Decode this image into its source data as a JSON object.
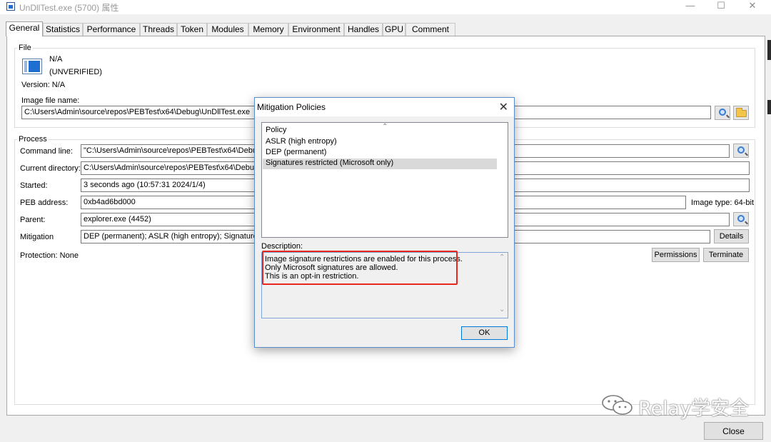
{
  "window": {
    "title": "UnDllTest.exe (5700) 属性",
    "minimize": "—",
    "maximize": "☐",
    "close": "✕"
  },
  "tabs": [
    "General",
    "Statistics",
    "Performance",
    "Threads",
    "Token",
    "Modules",
    "Memory",
    "Environment",
    "Handles",
    "GPU",
    "Comment"
  ],
  "file": {
    "group_label": "File",
    "description": "N/A",
    "verified": "(UNVERIFIED)",
    "version": "Version: N/A",
    "image_file_name_label": "Image file name:",
    "image_file_name": "C:\\Users\\Admin\\source\\repos\\PEBTest\\x64\\Debug\\UnDllTest.exe"
  },
  "process": {
    "group_label": "Process",
    "command_line_label": "Command line:",
    "command_line": "\"C:\\Users\\Admin\\source\\repos\\PEBTest\\x64\\Debug\\UnD",
    "current_directory_label": "Current directory:",
    "current_directory": "C:\\Users\\Admin\\source\\repos\\PEBTest\\x64\\Debug\\",
    "started_label": "Started:",
    "started": "3 seconds ago (10:57:31 2024/1/4)",
    "peb_address_label": "PEB address:",
    "peb_address": "0xb4ad6bd000",
    "image_type": "Image type:  64-bit",
    "parent_label": "Parent:",
    "parent": "explorer.exe (4452)",
    "mitigation_label": "Mitigation",
    "mitigation": "DEP (permanent); ASLR (high entropy); Signatures restr",
    "details_button": "Details",
    "protection": "Protection: None",
    "permissions_button": "Permissions",
    "terminate_button": "Terminate"
  },
  "dialog": {
    "title": "Mitigation Policies",
    "close": "✕",
    "list_header": "Policy",
    "sort_indicator": "⌃",
    "policies": [
      "ASLR (high entropy)",
      "DEP (permanent)",
      "Signatures restricted (Microsoft only)"
    ],
    "selected_index": 2,
    "description_label": "Description:",
    "description_lines": [
      "Image signature restrictions are enabled for this process.",
      "Only Microsoft signatures are allowed.",
      "This is an opt-in restriction."
    ],
    "ok_button": "OK",
    "scroll_up": "⌃",
    "scroll_down": "⌄"
  },
  "footer": {
    "close_button": "Close"
  },
  "watermark": {
    "text": "Relay学安全"
  },
  "colors": {
    "highlight_border": "#e8261e",
    "dialog_border": "#5b8ec9",
    "selected_row": "#d9d9d9"
  }
}
